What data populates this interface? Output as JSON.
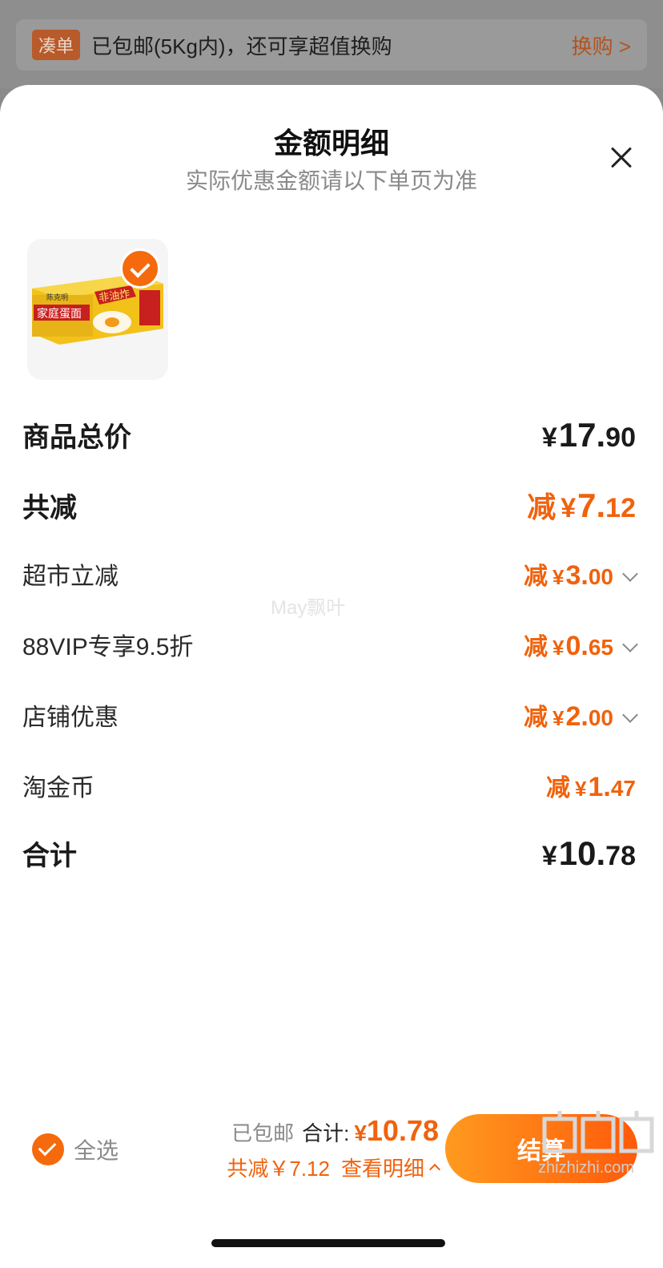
{
  "banner": {
    "tag": "凑单",
    "text": "已包邮(5Kg内)，还可享超值换购",
    "link": "换购 >"
  },
  "sheet": {
    "title": "金额明细",
    "subtitle": "实际优惠金额请以下单页为准"
  },
  "product": {
    "image_alt": "家庭蛋面",
    "box_brand": "陈克明",
    "box_name": "家庭蛋面",
    "box_badge": "非油炸",
    "selected": true
  },
  "rows": [
    {
      "label": "商品总价",
      "prefix": "",
      "yen": "¥",
      "int": "17.",
      "dec": "90"
    },
    {
      "label": "共减",
      "prefix": "减",
      "yen": "¥",
      "int": "7.",
      "dec": "12"
    },
    {
      "label": "超市立减",
      "prefix": "减",
      "yen": "¥",
      "int": "3.",
      "dec": "00"
    },
    {
      "label": "88VIP专享9.5折",
      "prefix": "减",
      "yen": "¥",
      "int": "0.",
      "dec": "65"
    },
    {
      "label": "店铺优惠",
      "prefix": "减",
      "yen": "¥",
      "int": "2.",
      "dec": "00"
    },
    {
      "label": "淘金币",
      "prefix": "减",
      "yen": "¥",
      "int": "1.",
      "dec": "47"
    },
    {
      "label": "合计",
      "prefix": "",
      "yen": "¥",
      "int": "10.",
      "dec": "78"
    }
  ],
  "watermark": "May飘叶",
  "footer": {
    "select_all": "全选",
    "shipping": "已包邮",
    "total_label": "合计:",
    "total_yen": "¥",
    "total_value": "10.78",
    "discount_text": "共减￥7.12",
    "detail_link": "查看明细",
    "checkout": "结算"
  },
  "corner_logo": "zhizhizhi.com",
  "colors": {
    "accent": "#f0620d",
    "checkout_start": "#ff9a1f",
    "checkout_end": "#ff5a0a"
  }
}
